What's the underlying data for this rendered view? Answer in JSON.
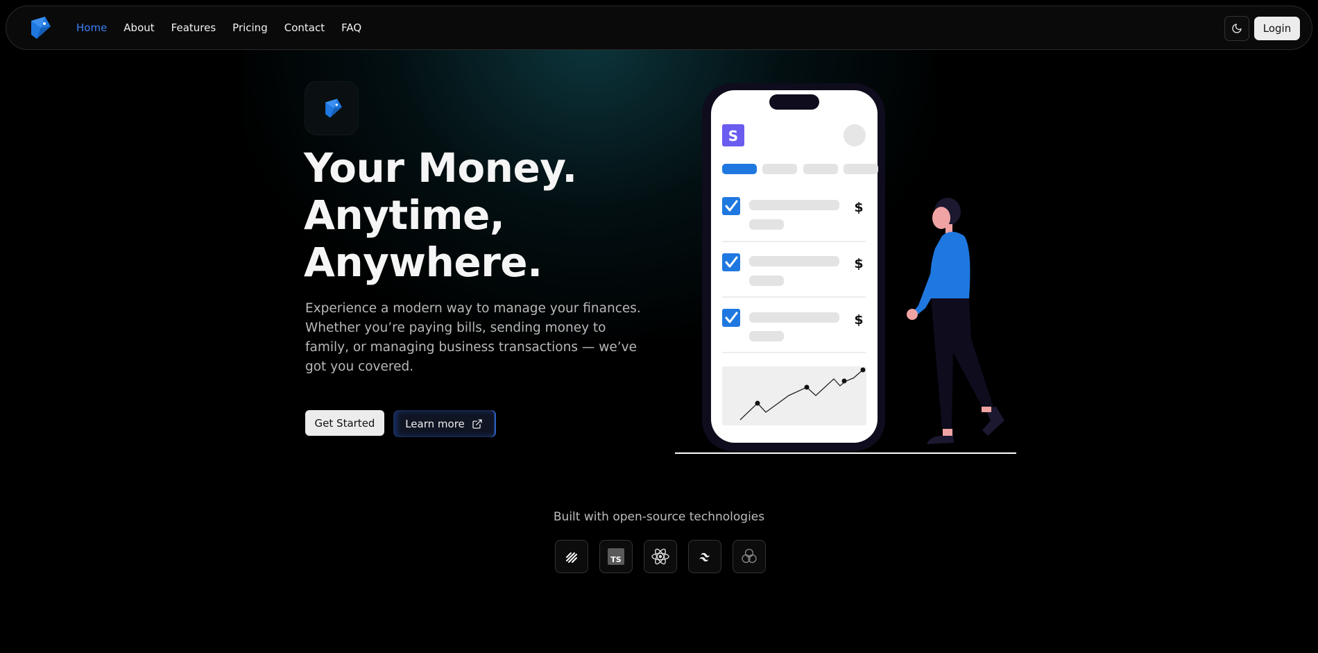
{
  "nav": {
    "logo_icon": "brand-logo-icon",
    "links": [
      {
        "label": "Home",
        "active": true
      },
      {
        "label": "About",
        "active": false
      },
      {
        "label": "Features",
        "active": false
      },
      {
        "label": "Pricing",
        "active": false
      },
      {
        "label": "Contact",
        "active": false
      },
      {
        "label": "FAQ",
        "active": false
      }
    ],
    "theme_icon": "moon-icon",
    "login_label": "Login",
    "active_color": "#3b82f6"
  },
  "hero": {
    "title_lines": [
      "Your Money.",
      "Anytime,",
      "Anywhere."
    ],
    "description": "Experience a modern way to manage your finances. Whether you’re paying bills, sending money to family, or managing business transactions — we’ve got you covered.",
    "primary_button": "Get Started",
    "secondary_button": "Learn more",
    "secondary_icon": "external-link-icon"
  },
  "phone": {
    "app_letter": "S",
    "app_color": "#6b5cf0",
    "rows": [
      {
        "checked": true,
        "symbol": "$"
      },
      {
        "checked": true,
        "symbol": "$"
      },
      {
        "checked": true,
        "symbol": "$"
      }
    ],
    "accent": "#1f78e0"
  },
  "tech": {
    "caption": "Built with open-source technologies",
    "icons": [
      "shadcn-icon",
      "typescript-icon",
      "react-icon",
      "tailwind-icon",
      "three-js-icon"
    ],
    "ts_label": "TS"
  }
}
